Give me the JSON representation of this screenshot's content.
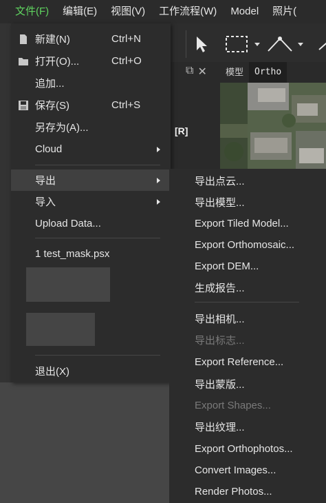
{
  "menubar": [
    {
      "label": "文件(F)",
      "active": true
    },
    {
      "label": "编辑(E)",
      "active": false
    },
    {
      "label": "视图(V)",
      "active": false
    },
    {
      "label": "工作流程(W)",
      "active": false
    },
    {
      "label": "Model",
      "active": false
    },
    {
      "label": "照片(",
      "active": false
    }
  ],
  "file_menu": {
    "items": [
      {
        "label": "新建(N)",
        "shortcut": "Ctrl+N",
        "icon": "new-document-icon"
      },
      {
        "label": "打开(O)...",
        "shortcut": "Ctrl+O",
        "icon": "open-folder-icon"
      },
      {
        "label": "追加...",
        "shortcut": ""
      },
      {
        "label": "保存(S)",
        "shortcut": "Ctrl+S",
        "icon": "save-icon"
      },
      {
        "label": "另存为(A)...",
        "shortcut": ""
      },
      {
        "label": "Cloud",
        "submenu": true
      },
      {
        "label": "导出",
        "submenu": true,
        "highlighted": true
      },
      {
        "label": "导入",
        "submenu": true
      },
      {
        "label": "Upload Data...",
        "shortcut": ""
      },
      {
        "label": "1 test_mask.psx",
        "shortcut": ""
      },
      {
        "label": "退出(X)",
        "shortcut": ""
      }
    ]
  },
  "export_submenu": {
    "items": [
      {
        "label": "导出点云...",
        "enabled": true
      },
      {
        "label": "导出模型...",
        "enabled": true
      },
      {
        "label": "Export Tiled Model...",
        "enabled": true
      },
      {
        "label": "Export Orthomosaic...",
        "enabled": true
      },
      {
        "label": "Export DEM...",
        "enabled": true
      },
      {
        "label": "生成报告...",
        "enabled": true
      },
      {
        "label": "导出相机...",
        "enabled": true
      },
      {
        "label": "导出标志...",
        "enabled": false
      },
      {
        "label": "Export Reference...",
        "enabled": true
      },
      {
        "label": "导出蒙版...",
        "enabled": true
      },
      {
        "label": "Export Shapes...",
        "enabled": false
      },
      {
        "label": "导出纹理...",
        "enabled": true
      },
      {
        "label": "Export Orthophotos...",
        "enabled": true
      },
      {
        "label": "Convert Images...",
        "enabled": true
      },
      {
        "label": "Render Photos...",
        "enabled": true
      }
    ]
  },
  "view_tabs": {
    "model": "模型",
    "ortho": "Ortho"
  },
  "panel_label": "[R]",
  "colors": {
    "accent": "#5fd35f",
    "menu_bg": "#2c2c2c",
    "highlight": "#404040",
    "disabled": "#7a7a7a"
  }
}
